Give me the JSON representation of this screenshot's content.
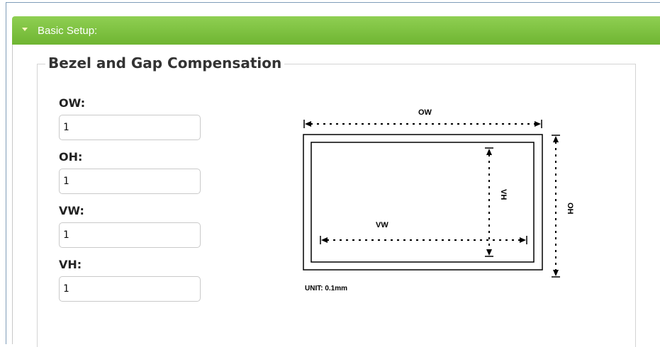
{
  "section": {
    "title": "Basic Setup:"
  },
  "group": {
    "legend": "Bezel and Gap Compensation"
  },
  "fields": [
    {
      "label": "OW:",
      "value": "1"
    },
    {
      "label": "OH:",
      "value": "1"
    },
    {
      "label": "VW:",
      "value": "1"
    },
    {
      "label": "VH:",
      "value": "1"
    }
  ],
  "diagram": {
    "ow": "OW",
    "oh": "OH",
    "vw": "VW",
    "vh": "VH",
    "unit": "UNIT: 0.1mm"
  },
  "colors": {
    "header_green": "#7cc142",
    "header_text": "#ffffff"
  }
}
